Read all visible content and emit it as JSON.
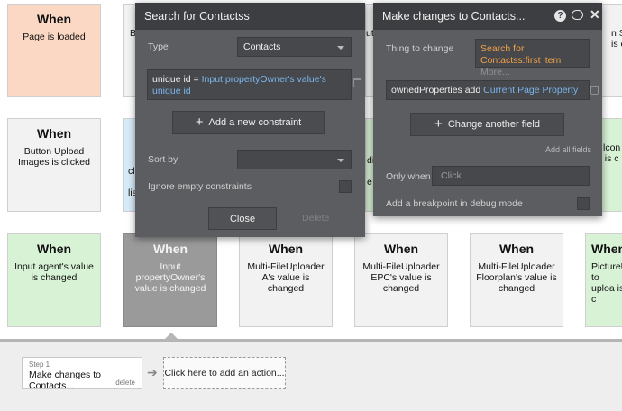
{
  "canvas": {
    "cards": [
      {
        "when": "When",
        "desc": "Page is loaded"
      },
      {
        "when": "When",
        "desc": "Button Upload Images is clicked"
      },
      {
        "when": "When",
        "desc": "Input agent's value is changed"
      },
      {
        "when": "When",
        "desc": "Input propertyOwner's value is changed"
      },
      {
        "when": "When",
        "desc": "Multi-FileUploader A's value is changed"
      },
      {
        "when": "When",
        "desc": "Multi-FileUploader EPC's value is changed"
      },
      {
        "when": "When",
        "desc": "Multi-FileUploader Floorplan's value is changed"
      },
      {
        "when": "When",
        "desc": "PictureU to uploa is c"
      }
    ],
    "fragments": {
      "b_top": "B",
      "ut": "ut",
      "right_top": "n S\nis c",
      "cl": "cl",
      "lis": "lis",
      "di": "di",
      "e": "e",
      "lcon": "lcon\nis c",
      "picture_when": "When"
    }
  },
  "search_panel": {
    "title": "Search for Contactss",
    "type_label": "Type",
    "type_value": "Contacts",
    "constraint_key": "unique id =",
    "constraint_value": "Input propertyOwner's value's unique id",
    "add_constraint": "Add a new constraint",
    "sort_label": "Sort by",
    "ignore_label": "Ignore empty constraints",
    "close_label": "Close",
    "delete_label": "Delete"
  },
  "changes_panel": {
    "title": "Make changes to Contacts...",
    "thing_label": "Thing to change",
    "thing_value": "Search for Contactss:first item",
    "thing_more": "More...",
    "field_key": "ownedProperties add",
    "field_value": "Current Page Property",
    "change_another": "Change another field",
    "add_all": "Add all fields",
    "only_when_label": "Only when",
    "only_when_placeholder": "Click",
    "breakpoint_label": "Add a breakpoint in debug mode"
  },
  "actions": {
    "step_label": "Step 1",
    "step_title": "Make changes to Contacts...",
    "step_delete": "delete",
    "add_action": "Click here to add an action..."
  },
  "colors": {
    "panel_bg": "#5b5d60",
    "panel_header": "#3c3e41",
    "link_blue": "#7ab6ee",
    "accent_orange": "#f0a04a",
    "card_orange": "#fbd8c4",
    "card_selected": "#9a9a9a"
  }
}
